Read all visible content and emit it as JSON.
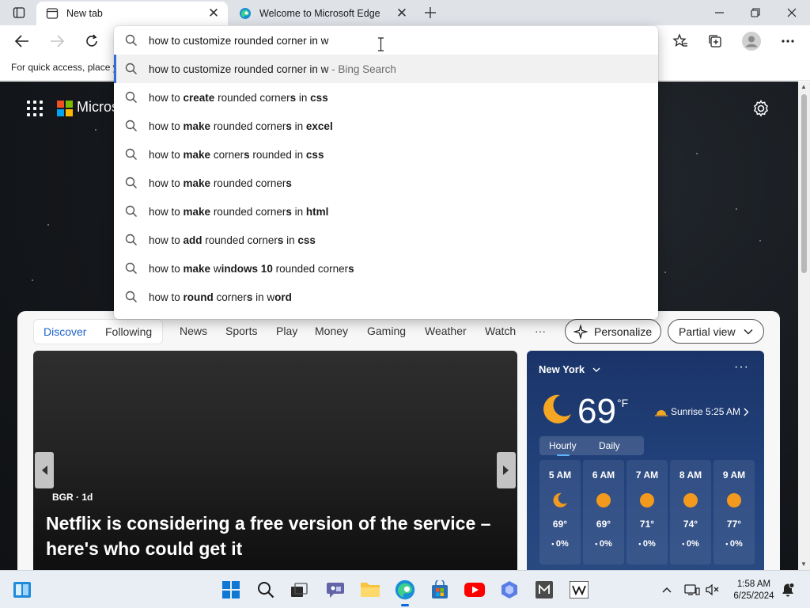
{
  "tabs": [
    {
      "title": "New tab",
      "active": true
    },
    {
      "title": "Welcome to Microsoft Edge",
      "active": false
    }
  ],
  "window": {
    "minimize": "–",
    "restore": "❐",
    "close": "✕"
  },
  "favbar": {
    "text": "For quick access, place y"
  },
  "omnibox": {
    "value": "how to customize rounded corner in w",
    "suggestions": [
      {
        "html": "how to customize rounded corner in w",
        "suffix": " - Bing Search",
        "highlight": true
      },
      {
        "html": "how to <b>create</b> rounded corner<b>s</b> in <b>css</b>"
      },
      {
        "html": "how to <b>make</b> rounded corner<b>s</b> in <b>excel</b>"
      },
      {
        "html": "how to <b>make</b> corner<b>s</b> rounded in <b>css</b>"
      },
      {
        "html": "how to <b>make</b> rounded corner<b>s</b>"
      },
      {
        "html": "how to <b>make</b> rounded corner<b>s</b> in <b>html</b>"
      },
      {
        "html": "how to <b>add</b> rounded corner<b>s</b> in <b>css</b>"
      },
      {
        "html": "how to <b>make</b> w<b>indows 10</b> rounded corner<b>s</b>"
      },
      {
        "html": "how to <b>round</b> corner<b>s</b> in w<b>ord</b>"
      }
    ]
  },
  "newtab": {
    "brand": "Micros",
    "feed_tabs": {
      "discover": "Discover",
      "following": "Following"
    },
    "nav": [
      "News",
      "Sports",
      "Play",
      "Money",
      "Gaming",
      "Weather",
      "Watch",
      "···"
    ],
    "personalize": "Personalize",
    "partial_view": "Partial view"
  },
  "news": {
    "source": "BGR · 1d",
    "headline": "Netflix is considering a free version of the service – here's who could get it"
  },
  "weather": {
    "location": "New York",
    "more": "···",
    "temp": "69",
    "unit": "°F",
    "sunrise": "Sunrise 5:25 AM",
    "tabs": {
      "hourly": "Hourly",
      "daily": "Daily"
    },
    "hours": [
      {
        "time": "5 AM",
        "icon": "moon",
        "temp": "69°",
        "precip": "0%"
      },
      {
        "time": "6 AM",
        "icon": "sun",
        "temp": "69°",
        "precip": "0%"
      },
      {
        "time": "7 AM",
        "icon": "sun",
        "temp": "71°",
        "precip": "0%"
      },
      {
        "time": "8 AM",
        "icon": "sun",
        "temp": "74°",
        "precip": "0%"
      },
      {
        "time": "9 AM",
        "icon": "sun",
        "temp": "77°",
        "precip": "0%"
      }
    ]
  },
  "taskbar": {
    "time": "1:58 AM",
    "date": "6/25/2024"
  },
  "colors": {
    "accent": "#1e64c8",
    "tabstrip": "#dfe3e8",
    "weather_bg": "#1a3468",
    "sun": "#f39a1e"
  }
}
